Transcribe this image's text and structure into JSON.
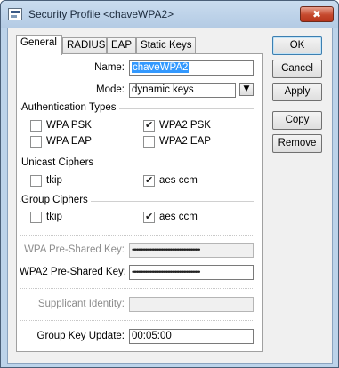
{
  "window": {
    "title": "Security Profile <chaveWPA2>",
    "close_glyph": "✖"
  },
  "tabs": [
    {
      "label": "General",
      "active": true
    },
    {
      "label": "RADIUS",
      "active": false
    },
    {
      "label": "EAP",
      "active": false
    },
    {
      "label": "Static Keys",
      "active": false
    }
  ],
  "form": {
    "name_label": "Name:",
    "name_value": "chaveWPA2",
    "mode_label": "Mode:",
    "mode_value": "dynamic keys",
    "auth_types": {
      "title": "Authentication Types",
      "wpa_psk": {
        "label": "WPA PSK",
        "checked": false
      },
      "wpa2_psk": {
        "label": "WPA2 PSK",
        "checked": true
      },
      "wpa_eap": {
        "label": "WPA EAP",
        "checked": false
      },
      "wpa2_eap": {
        "label": "WPA2 EAP",
        "checked": false
      }
    },
    "unicast": {
      "title": "Unicast Ciphers",
      "tkip": {
        "label": "tkip",
        "checked": false
      },
      "aes_ccm": {
        "label": "aes ccm",
        "checked": true
      }
    },
    "group": {
      "title": "Group Ciphers",
      "tkip": {
        "label": "tkip",
        "checked": false
      },
      "aes_ccm": {
        "label": "aes ccm",
        "checked": true
      }
    },
    "wpa_psk_label": "WPA Pre-Shared Key:",
    "wpa_psk_value": "••••••••••••••••••••••••••••••••••••••••••••••",
    "wpa2_psk_label": "WPA2 Pre-Shared Key:",
    "wpa2_psk_value": "••••••••••••••••••••••••••••••••••••••••••••••",
    "supplicant_label": "Supplicant Identity:",
    "supplicant_value": "",
    "group_key_label": "Group Key Update:",
    "group_key_value": "00:05:00"
  },
  "buttons": {
    "ok": "OK",
    "cancel": "Cancel",
    "apply": "Apply",
    "copy": "Copy",
    "remove": "Remove"
  },
  "icons": {
    "window_icon": "window-app-icon",
    "dropdown": "▼"
  }
}
